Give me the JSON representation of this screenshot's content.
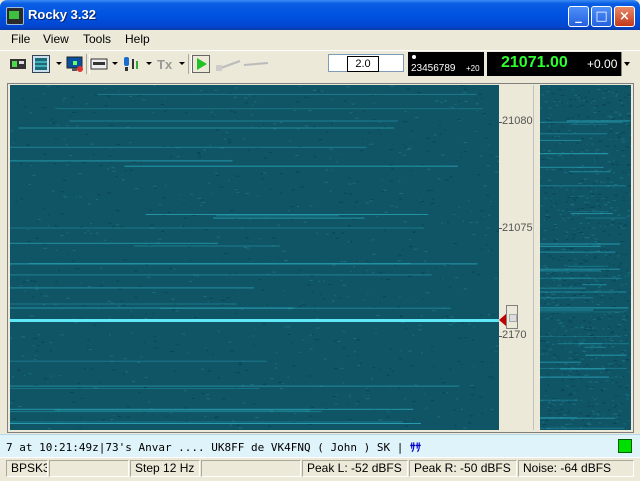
{
  "window": {
    "title": "Rocky 3.32"
  },
  "window_controls": {
    "minimize": "_",
    "maximize": "□",
    "close": "×"
  },
  "menu": {
    "file": "File",
    "view": "View",
    "tools": "Tools",
    "help": "Help"
  },
  "toolbar": {
    "icons": [
      "modem-icon",
      "waterfall-icon",
      "monitor-icon",
      "keyboard-icon",
      "microphone-icon",
      "tx-icon",
      "play-icon",
      "slider-icon"
    ],
    "speed_value": "2.0",
    "macro_digits": "23456789",
    "macro_suffix": "+20",
    "frequency": "21071.00",
    "offset": "+0.00"
  },
  "waterfall": {
    "scale_labels": [
      "21080",
      "21075",
      "2170"
    ],
    "accent_color": "#2fb7c9",
    "background_color": "#0f5566"
  },
  "text_strip": {
    "received": "7 at 10:21:49z|73's Anvar .... UK8FF de VK4FNQ ( John ) SK | ",
    "cursor": "ｻｻ"
  },
  "status": {
    "mode": "BPSK3",
    "blank1": "",
    "step": "Step 12 Hz",
    "blank2": "",
    "peak_l": "Peak L: -52 dBFS",
    "peak_r": "Peak R: -50 dBFS",
    "noise": "Noise: -64 dBFS"
  }
}
